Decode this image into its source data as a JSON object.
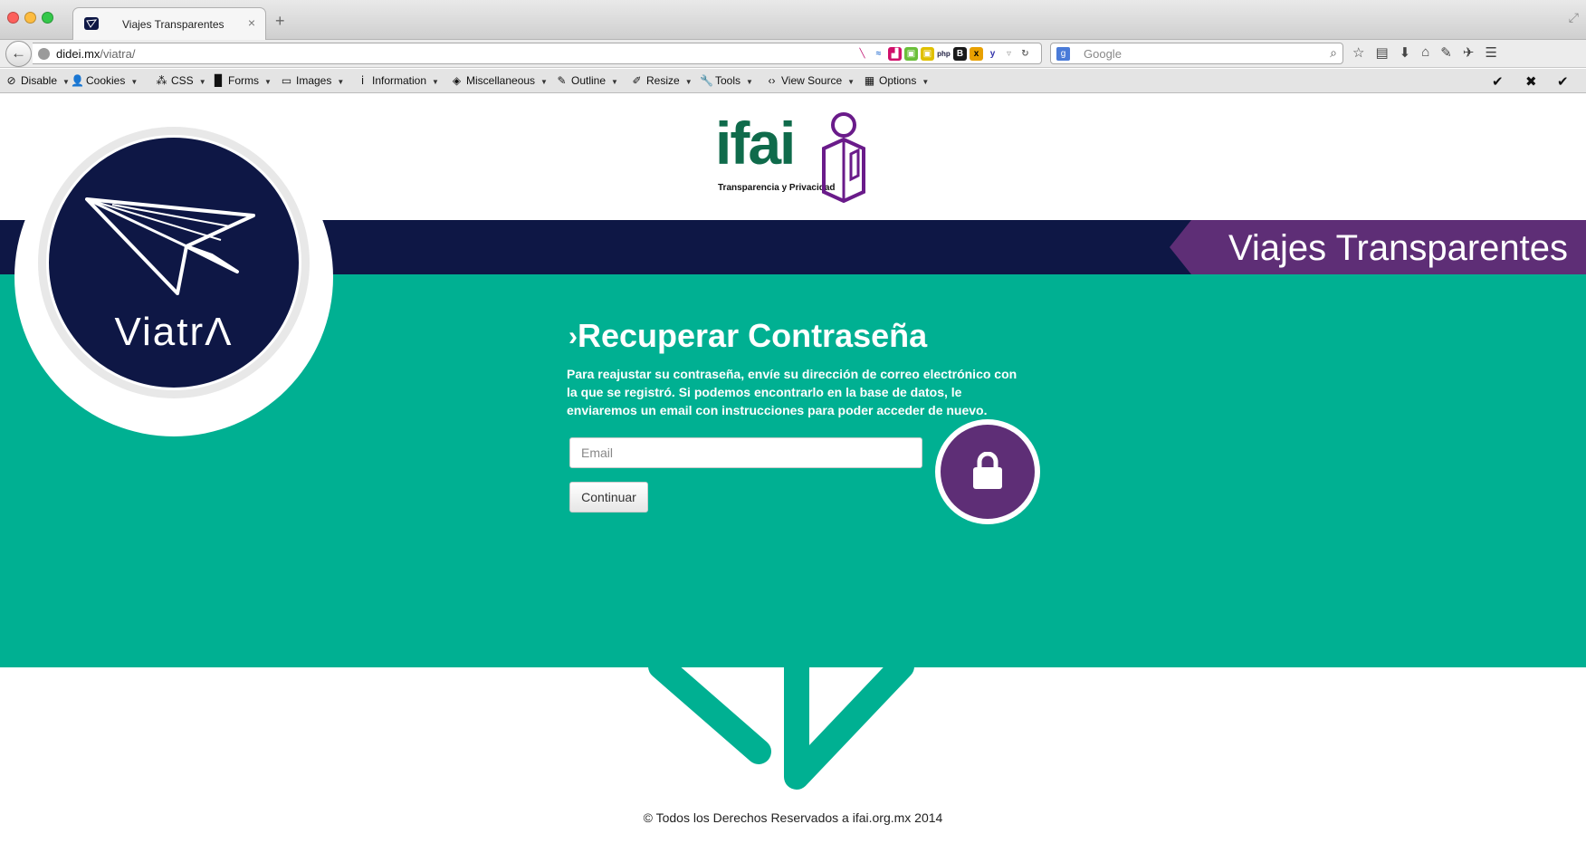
{
  "browser": {
    "tab_title": "Viajes Transparentes",
    "tab_close": "×",
    "new_tab": "+",
    "url_domain": "didei.mx",
    "url_path": "/viatra/",
    "search_placeholder": "Google"
  },
  "devtoolbar": {
    "items": [
      {
        "label": "Disable",
        "icon": "ban-icon"
      },
      {
        "label": "Cookies",
        "icon": "person-icon"
      },
      {
        "label": "CSS",
        "icon": "wand-icon"
      },
      {
        "label": "Forms",
        "icon": "clipboard-icon"
      },
      {
        "label": "Images",
        "icon": "image-icon"
      },
      {
        "label": "Information",
        "icon": "info-icon"
      },
      {
        "label": "Miscellaneous",
        "icon": "cube-icon"
      },
      {
        "label": "Outline",
        "icon": "pencil-icon"
      },
      {
        "label": "Resize",
        "icon": "resize-icon"
      },
      {
        "label": "Tools",
        "icon": "wrench-icon"
      },
      {
        "label": "View Source",
        "icon": "code-icon"
      },
      {
        "label": "Options",
        "icon": "grid-icon"
      }
    ]
  },
  "page": {
    "logo_text": "ifai",
    "logo_subtitle": "Transparencia y Privacidad",
    "banner_title": "Viajes Transparentes",
    "badge_text": "ViatrΛ",
    "form_title_chevron": "›",
    "form_title": "Recuperar Contraseña",
    "form_description": "Para reajustar su contraseña, envíe su dirección de correo electrónico con la que se registró. Si podemos encontrarlo en la base de datos, le enviaremos un email con instrucciones para poder acceder de nuevo.",
    "email_placeholder": "Email",
    "continue_label": "Continuar",
    "footer": "© Todos los Derechos Reservados a ifai.org.mx 2014"
  },
  "colors": {
    "teal": "#00b092",
    "navy": "#0e1745",
    "purple": "#5e2e76",
    "logo_green": "#0f6b4b"
  }
}
